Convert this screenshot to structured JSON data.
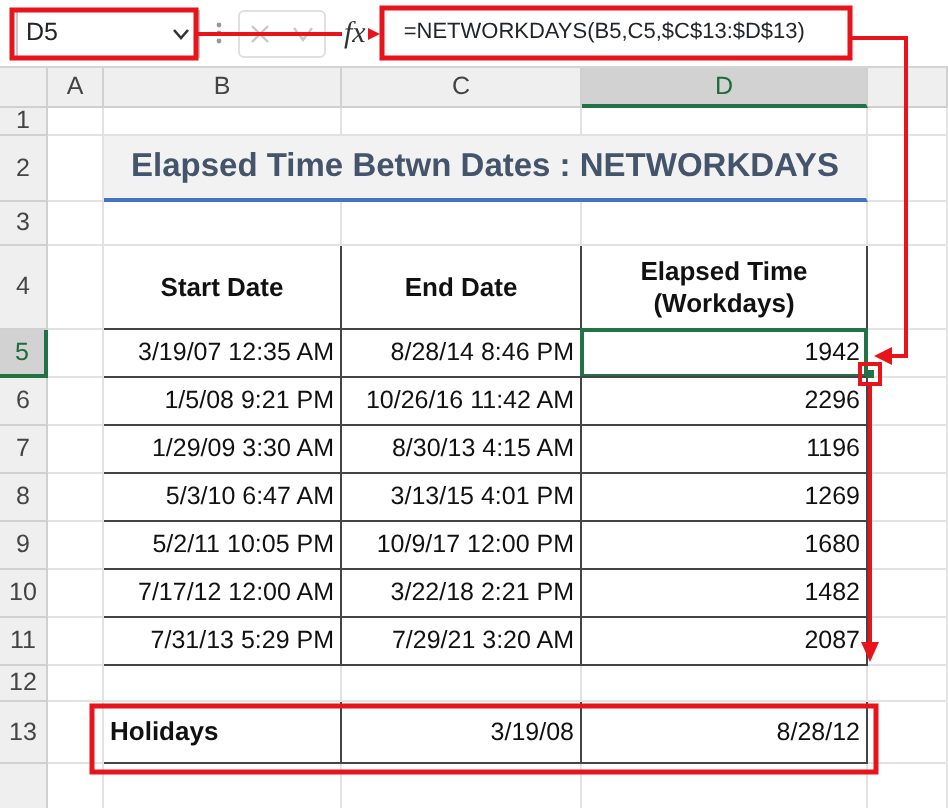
{
  "formula_bar": {
    "name_box": "D5",
    "fx_label": "fx",
    "formula": "=NETWORKDAYS(B5,C5,$C$13:$D$13)"
  },
  "columns": [
    {
      "label": "A",
      "selected": false
    },
    {
      "label": "B",
      "selected": false
    },
    {
      "label": "C",
      "selected": false
    },
    {
      "label": "D",
      "selected": true
    }
  ],
  "rows": [
    {
      "label": "1",
      "selected": false
    },
    {
      "label": "2",
      "selected": false
    },
    {
      "label": "3",
      "selected": false
    },
    {
      "label": "4",
      "selected": false
    },
    {
      "label": "5",
      "selected": true
    },
    {
      "label": "6",
      "selected": false
    },
    {
      "label": "7",
      "selected": false
    },
    {
      "label": "8",
      "selected": false
    },
    {
      "label": "9",
      "selected": false
    },
    {
      "label": "10",
      "selected": false
    },
    {
      "label": "11",
      "selected": false
    },
    {
      "label": "12",
      "selected": false
    },
    {
      "label": "13",
      "selected": false
    }
  ],
  "title": "Elapsed Time Betwn Dates : NETWORKDAYS",
  "table": {
    "columns": [
      "Start Date",
      "End Date",
      "Elapsed Time (Workdays)"
    ],
    "rows": [
      {
        "start": "3/19/07 12:35 AM",
        "end": "8/28/14 8:46 PM",
        "elapsed": "1942",
        "selected": true
      },
      {
        "start": "1/5/08 9:21 PM",
        "end": "10/26/16 11:42 AM",
        "elapsed": "2296",
        "selected": false
      },
      {
        "start": "1/29/09 3:30 AM",
        "end": "8/30/13 4:15 AM",
        "elapsed": "1196",
        "selected": false
      },
      {
        "start": "5/3/10 6:47 AM",
        "end": "3/13/15 4:01 PM",
        "elapsed": "1269",
        "selected": false
      },
      {
        "start": "5/2/11 10:05 PM",
        "end": "10/9/17 12:00 PM",
        "elapsed": "1680",
        "selected": false
      },
      {
        "start": "7/17/12 12:00 AM",
        "end": "3/22/18 2:21 PM",
        "elapsed": "1482",
        "selected": false
      },
      {
        "start": "7/31/13 5:29 PM",
        "end": "7/29/21 3:20 AM",
        "elapsed": "2087",
        "selected": false
      }
    ]
  },
  "holidays": {
    "label": "Holidays",
    "dates": [
      "3/19/08",
      "8/28/12"
    ]
  }
}
